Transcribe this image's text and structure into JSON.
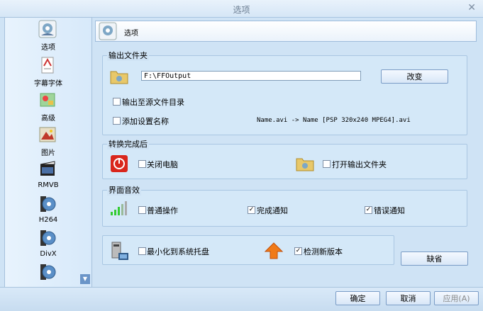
{
  "window": {
    "title": "选项"
  },
  "sidebar": {
    "items": [
      {
        "label": "选项",
        "icon": "options-icon"
      },
      {
        "label": "字幕字体",
        "icon": "subtitle-font-icon"
      },
      {
        "label": "高级",
        "icon": "advanced-icon"
      },
      {
        "label": "图片",
        "icon": "picture-icon"
      },
      {
        "label": "RMVB",
        "icon": "rmvb-icon"
      },
      {
        "label": "H264",
        "icon": "h264-icon"
      },
      {
        "label": "DivX",
        "icon": "divx-icon"
      }
    ]
  },
  "header": {
    "title": "选项"
  },
  "output": {
    "title": "输出文件夹",
    "path": "F:\\FFOutput",
    "change_label": "改变",
    "to_source_label": "输出至源文件目录",
    "add_setting_label": "添加设置名称",
    "example": "Name.avi  -> Name [PSP 320x240 MPEG4].avi"
  },
  "after": {
    "title": "转换完成后",
    "shutdown_label": "关闭电脑",
    "open_folder_label": "打开输出文件夹"
  },
  "sound": {
    "title": "界面音效",
    "normal_label": "普通操作",
    "complete_label": "完成通知",
    "error_label": "错误通知",
    "normal_checked": false,
    "complete_checked": true,
    "error_checked": true
  },
  "misc": {
    "tray_label": "最小化到系统托盘",
    "update_label": "检测新版本",
    "tray_checked": false,
    "update_checked": true,
    "default_label": "缺省"
  },
  "footer": {
    "ok_label": "确定",
    "cancel_label": "取消",
    "apply_label": "应用(A)"
  },
  "colors": {
    "accent": "#3a78c9",
    "panel": "#d4e8f8"
  }
}
